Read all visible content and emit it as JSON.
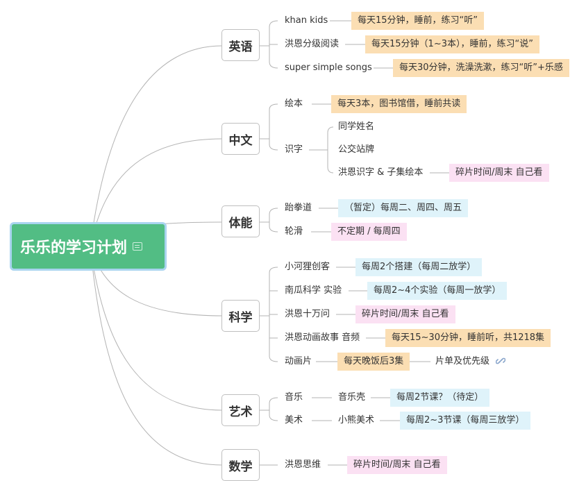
{
  "root": {
    "title": "乐乐的学习计划"
  },
  "english": {
    "title": "英语",
    "items": [
      {
        "label": "khan kids",
        "tag": "每天15分钟，睡前，练习“听”"
      },
      {
        "label": "洪恩分级阅读",
        "tag": "每天15分钟（1~3本），睡前，练习“说”"
      },
      {
        "label": "super simple songs",
        "tag": "每天30分钟，洗澡洗漱，练习“听”+乐感"
      }
    ]
  },
  "chinese": {
    "title": "中文",
    "huiben": {
      "label": "绘本",
      "tag": "每天3本，图书馆借，睡前共读"
    },
    "shizi": {
      "label": "识字",
      "sub": [
        {
          "label": "同学姓名"
        },
        {
          "label": "公交站牌"
        },
        {
          "label": "洪恩识字 & 子集绘本",
          "tag": "碎片时间/周末 自己看"
        }
      ]
    }
  },
  "fitness": {
    "title": "体能",
    "items": [
      {
        "label": "跆拳道",
        "tag": "（暂定）每周二、周四、周五"
      },
      {
        "label": "轮滑",
        "tag": "不定期 / 每周四"
      }
    ]
  },
  "science": {
    "title": "科学",
    "items": [
      {
        "label": "小河狸创客",
        "tag": "每周2个搭建（每周二放学）"
      },
      {
        "label": "南瓜科学 实验",
        "tag": "每周2~4个实验（每周一放学）"
      },
      {
        "label": "洪恩十万问",
        "tag": "碎片时间/周末 自己看"
      },
      {
        "label": "洪恩动画故事 音频",
        "tag": "每天15~30分钟，睡前听，共1218集"
      },
      {
        "label": "动画片",
        "tag": "每天晚饭后3集",
        "extra": "片单及优先级"
      }
    ]
  },
  "art": {
    "title": "艺术",
    "items": [
      {
        "label": "音乐",
        "sub": "音乐壳",
        "tag": "每周2节课？（待定）"
      },
      {
        "label": "美术",
        "sub": "小熊美术",
        "tag": "每周2~3节课（每周三放学）"
      }
    ]
  },
  "math": {
    "title": "数学",
    "items": [
      {
        "label": "洪恩思维",
        "tag": "碎片时间/周末 自己看"
      }
    ]
  }
}
